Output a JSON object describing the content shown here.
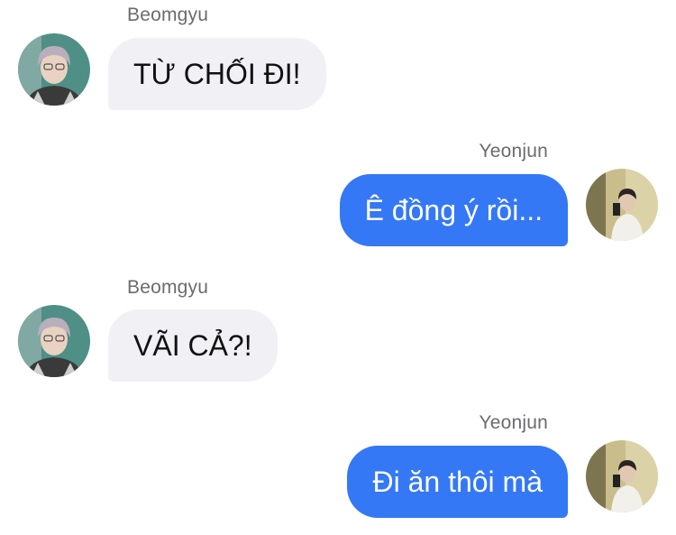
{
  "messages": [
    {
      "sender": "Beomgyu",
      "text": "TỪ CHỐI ĐI!",
      "direction": "incoming",
      "avatar": "beomgyu-avatar"
    },
    {
      "sender": "Yeonjun",
      "text": "Ê đồng ý rồi...",
      "direction": "outgoing",
      "avatar": "yeonjun-avatar"
    },
    {
      "sender": "Beomgyu",
      "text": "VÃI CẢ?!",
      "direction": "incoming",
      "avatar": "beomgyu-avatar"
    },
    {
      "sender": "Yeonjun",
      "text": "Đi ăn thôi mà",
      "direction": "outgoing",
      "avatar": "yeonjun-avatar"
    }
  ],
  "colors": {
    "incoming_bubble": "#f1f0f5",
    "outgoing_bubble": "#3478f6",
    "sender_name": "#6b6b70"
  }
}
